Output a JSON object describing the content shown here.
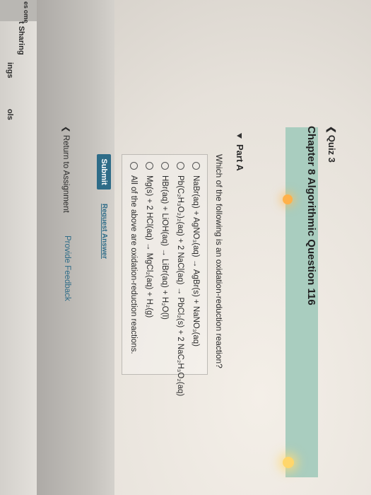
{
  "sidebar": {
    "top_text": "es",
    "top_text2": "ome",
    "items": [
      {
        "label": "t Sharing"
      },
      {
        "label": "ings"
      },
      {
        "label": "ols"
      }
    ]
  },
  "header": {
    "breadcrumb": "Quiz 3",
    "title": "Chapter 8 Algorithmic Question 116"
  },
  "part": {
    "label": "Part A",
    "question": "Which of the following is an oxidation-reduction reaction?",
    "choices": [
      {
        "text": "NaBr(aq) + AgNO₃(aq) → AgBr(s) + NaNO₃(aq)"
      },
      {
        "text": "Pb(C₂H₃O₂)₂(aq) + 2 NaCl(aq) → PbCl₂(s) + 2 NaC₂H₃O₂(aq)"
      },
      {
        "text": "HBr(aq) + LiOH(aq) → LiBr(aq) + H₂O(l)"
      },
      {
        "text": "Mg(s) + 2 HCl(aq) → MgCl₂(aq) + H₂(g)"
      },
      {
        "text": "All of the above are oxidation-reduction reactions."
      }
    ],
    "submit_label": "Submit",
    "request_label": "Request Answer"
  },
  "footer": {
    "return_label": "Return to Assignment",
    "feedback_label": "Provide Feedback"
  }
}
